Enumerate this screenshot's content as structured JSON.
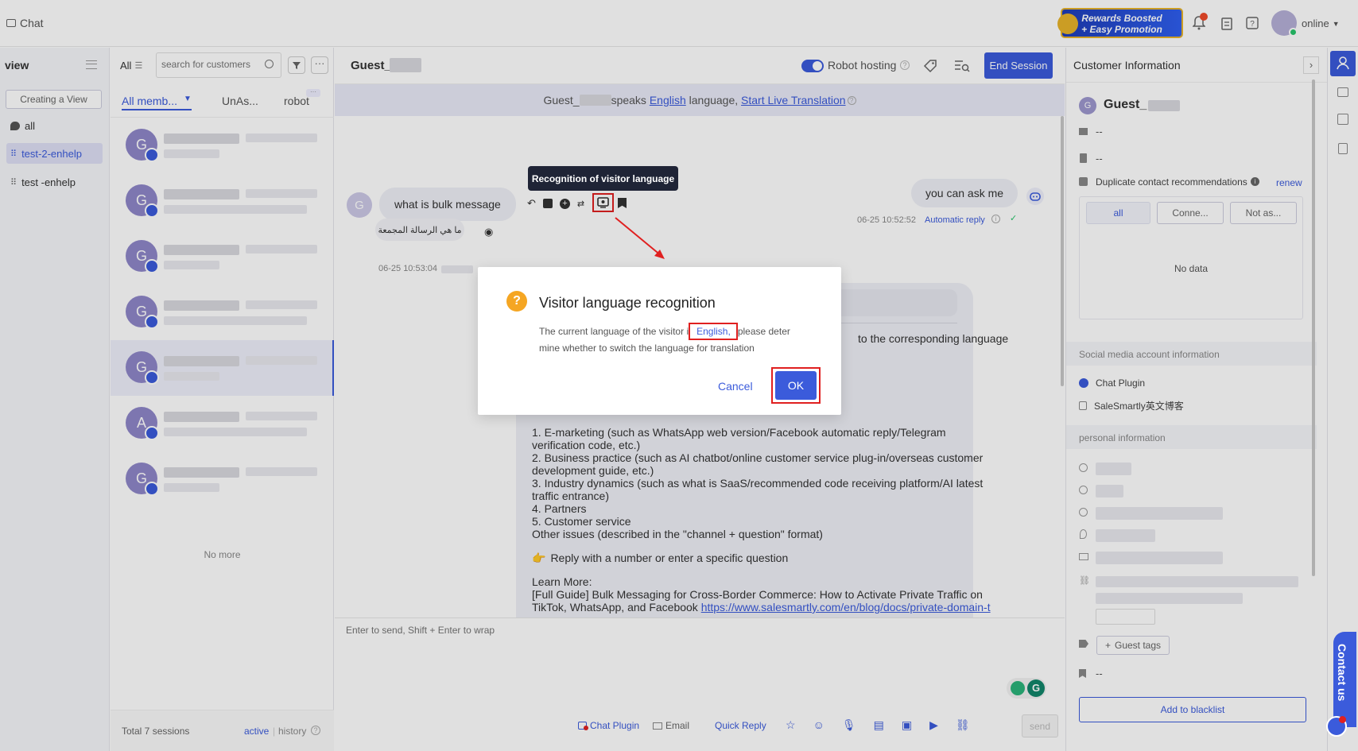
{
  "topbar": {
    "title": "Chat",
    "promo_line1": "Rewards Boosted",
    "promo_line2": "+ Easy Promotion",
    "status": "online"
  },
  "views": {
    "title": "view",
    "create_button": "Creating a View",
    "items": [
      "all",
      "test-2-enhelp",
      "test -enhelp"
    ]
  },
  "sessions": {
    "filter_label": "All",
    "search_placeholder": "search for customers",
    "tabs": [
      "All memb...",
      "UnAs...",
      "robot"
    ],
    "avatars": [
      "G",
      "G",
      "G",
      "G",
      "G",
      "A",
      "G"
    ],
    "no_more": "No more",
    "footer_total": "Total 7 sessions",
    "footer_active": "active",
    "footer_history": "history"
  },
  "chat": {
    "guest_name": "Guest_",
    "robot_hosting": "Robot hosting",
    "end_session": "End Session",
    "banner_prefix": "Guest_",
    "banner_speaks": "speaks",
    "banner_lang": "English",
    "banner_mid": "language,",
    "banner_link": "Start Live Translation",
    "agent_msg": "you can ask me",
    "agent_time": "06-25 10:52:52",
    "agent_meta": "Automatic reply",
    "visitor_avatar": "G",
    "visitor_msg": "what is bulk message",
    "visitor_translation": "ما هي الرسالة المجمعة",
    "visitor_time": "06-25 10:53:04",
    "tooltip": "Recognition of visitor language",
    "bot_fragment": "to the corresponding language",
    "bot_lines": [
      "1. E-marketing (such as WhatsApp web version/Facebook automatic reply/Telegram",
      "verification code, etc.)",
      "2. Business practice (such as AI chatbot/online customer service plug-in/overseas customer",
      "development guide, etc.)",
      "3. Industry dynamics (such as what is SaaS/recommended code receiving platform/AI latest",
      "traffic entrance)",
      "4. Partners",
      "5. Customer service",
      "Other issues (described in the \"channel + question\" format)"
    ],
    "bot_reply_hint": "Reply with a number or enter a specific question",
    "bot_learn": "Learn More:",
    "bot_guide1": "[Full Guide] Bulk Messaging for Cross-Border Commerce: How to Activate Private Traffic on",
    "bot_guide2": "TikTok, WhatsApp, and Facebook",
    "bot_link": "https://www.salesmartly.com/en/blog/docs/private-domain-t",
    "input_placeholder": "Enter to send, Shift + Enter to wrap",
    "tool_chat_plugin": "Chat Plugin",
    "tool_email": "Email",
    "tool_quick_reply": "Quick Reply",
    "send": "send"
  },
  "dialog": {
    "title": "Visitor language recognition",
    "text_before": "The current language of the visitor i",
    "text_lang": "English,",
    "text_after": "please deter",
    "text_line2": "mine whether to switch the language for translation",
    "cancel": "Cancel",
    "ok": "OK"
  },
  "customer": {
    "header": "Customer Information",
    "avatar": "G",
    "name": "Guest_",
    "email": "--",
    "phone": "--",
    "dup_label": "Duplicate contact recommendations",
    "renew": "renew",
    "dup_tabs": [
      "all",
      "Conne...",
      "Not as..."
    ],
    "no_data": "No data",
    "social_header": "Social media account information",
    "social_items": [
      "Chat Plugin",
      "SaleSmartly英文博客"
    ],
    "personal_header": "personal information",
    "guest_tags": "Guest tags",
    "note": "--",
    "blacklist": "Add to blacklist",
    "contact_us": "Contact us"
  },
  "colors": {
    "primary": "#3b5bdb",
    "danger": "#e02020",
    "bg_light": "#f5f6fa"
  }
}
